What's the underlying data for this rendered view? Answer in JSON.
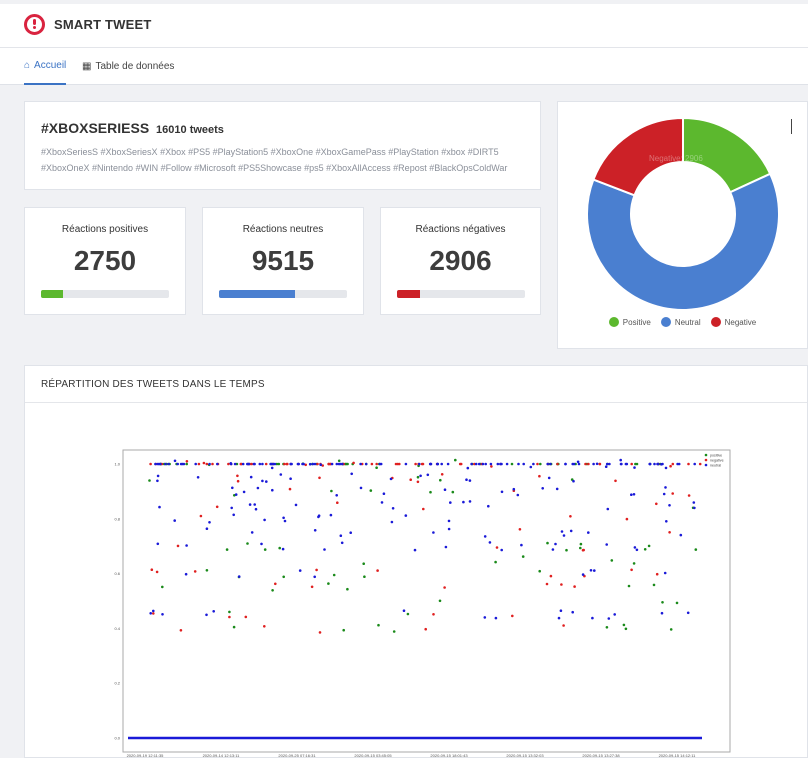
{
  "app": {
    "title": "SMART TWEET"
  },
  "tabs": [
    {
      "label": "Accueil",
      "icon": "home-icon",
      "active": true
    },
    {
      "label": "Table de données",
      "icon": "grid-icon",
      "active": false
    }
  ],
  "topic": {
    "title": "#XBOXSERIESS",
    "tweet_count": "16010 tweets",
    "hashtags_line1": "#XboxSeriesS #XboxSeriesX #Xbox #PS5 #PlayStation5 #XboxOne #XboxGamePass #PlayStation #xbox #DIRT5",
    "hashtags_line2": "#XboxOneX #Nintendo #WIN #Follow #Microsoft #PS5Showcase #ps5 #XboxAllAccess #Repost #BlackOpsColdWar"
  },
  "stats": [
    {
      "label": "Réactions positives",
      "value": "2750",
      "fraction": 0.17,
      "color": "#5cb82e"
    },
    {
      "label": "Réactions neutres",
      "value": "9515",
      "fraction": 0.59,
      "color": "#4a7fd0"
    },
    {
      "label": "Réactions négatives",
      "value": "2906",
      "fraction": 0.18,
      "color": "#cc2127"
    }
  ],
  "donut": {
    "hover_label": "Negative: 2906",
    "slices": [
      {
        "name": "Positive",
        "value": 2750,
        "color": "#5cb82e"
      },
      {
        "name": "Neutral",
        "value": 9515,
        "color": "#4a7fd0"
      },
      {
        "name": "Negative",
        "value": 2906,
        "color": "#cc2127"
      }
    ]
  },
  "timeline": {
    "title": "RÉPARTITION DES TWEETS DANS LE TEMPS"
  },
  "chart_data": {
    "type": "scatter",
    "title": "",
    "xlabel": "",
    "ylabel": "",
    "ylim": [
      0,
      1.0
    ],
    "y_ticks": [
      "1.0",
      "0.8",
      "0.6",
      "0.4",
      "0.2",
      "0.0"
    ],
    "x_ticks": [
      "2020-09-19 12:11:35",
      "2020-09-14 12:13:11",
      "2020-09-25 07:16:31",
      "2020-09-15 03:45:05",
      "2020-09-15 18:01:43",
      "2020-09-15 13:32:03",
      "2020-09-15 13:27:38",
      "2020-09-15 14:12:11"
    ],
    "legend": [
      "positive",
      "negative",
      "neutral"
    ],
    "legend_position": "top-right",
    "series": [
      {
        "name": "positive",
        "color": "#1a8a1a",
        "levels": [
          1.0,
          0.95,
          0.9,
          0.85,
          0.7,
          0.65,
          0.6,
          0.55,
          0.5,
          0.45,
          0.4
        ]
      },
      {
        "name": "negative",
        "color": "#e02020",
        "levels": [
          1.0,
          0.95,
          0.9,
          0.85,
          0.8,
          0.75,
          0.7,
          0.6,
          0.55,
          0.45,
          0.4
        ]
      },
      {
        "name": "neutral",
        "color": "#1a1ad8",
        "levels": [
          1.0,
          0.95,
          0.9,
          0.85,
          0.8,
          0.75,
          0.7,
          0.6,
          0.45,
          0.0
        ]
      }
    ]
  }
}
